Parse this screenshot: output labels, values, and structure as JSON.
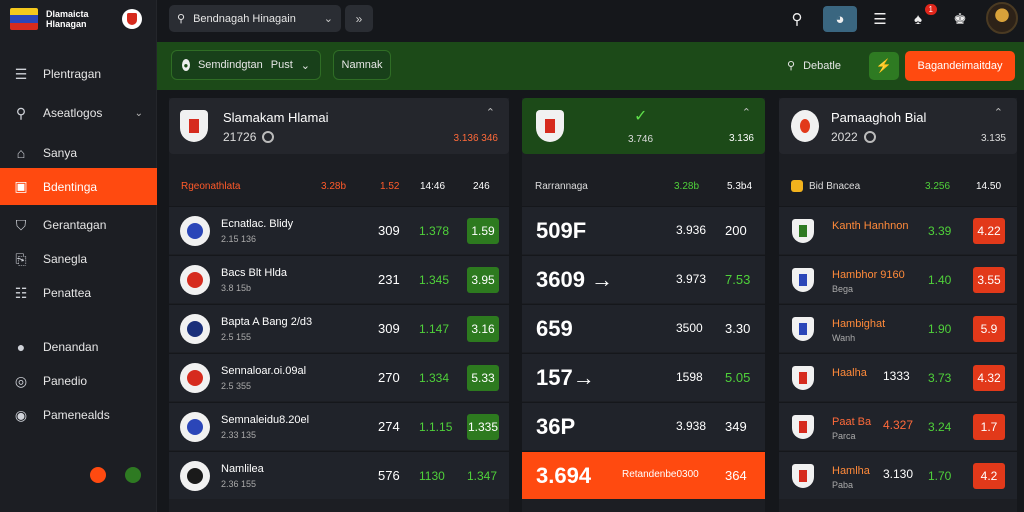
{
  "brand": {
    "line1": "Dlamaicta",
    "line2": "Hlanagan"
  },
  "sidebar": {
    "items": [
      {
        "label": "Plentragan",
        "icon": "menu-icon"
      },
      {
        "label": "Aseatlogos",
        "icon": "search-icon",
        "chevron": true
      },
      {
        "label": "Sanya",
        "icon": "home-icon"
      },
      {
        "label": "Bdentinga",
        "icon": "ticket-icon",
        "active": true
      },
      {
        "label": "Gerantagan",
        "icon": "shield-icon"
      },
      {
        "label": "Sanegla",
        "icon": "coupon-icon"
      },
      {
        "label": "Penattea",
        "icon": "list-icon"
      },
      {
        "label": "Denandan",
        "icon": "user-icon"
      },
      {
        "label": "Panedio",
        "icon": "gift-icon"
      },
      {
        "label": "Pamenealds",
        "icon": "chat-icon"
      }
    ],
    "dots": [
      {
        "color": "#ff4a10"
      },
      {
        "color": "#2e7a22"
      }
    ]
  },
  "topbar": {
    "search_placeholder": "Bendnagah Hinagain",
    "notif_count": "1"
  },
  "filterbar": {
    "league_label": "Semdindgtan",
    "league_value": "Pust",
    "tab_label": "Namnak",
    "search_label": "Debatle",
    "cta_label": "Bagandeimaitday"
  },
  "cards": [
    {
      "title": "Slamakam Hlamai",
      "sub": "21726",
      "odds": "3.136 346",
      "odds_color": "#ff6a3a"
    },
    {
      "title": "",
      "sub": "3.746",
      "odds": "3.136",
      "odds_color": "#ffffff"
    },
    {
      "title": "Pamaaghoh Bial",
      "sub": "2022",
      "odds": "3.135",
      "odds_color": "#dddddd"
    }
  ],
  "left_table": {
    "headers": [
      "Rgeonathlata",
      "3.28b",
      "1.52",
      "14:46",
      "246"
    ],
    "rows": [
      {
        "name": "Ecnatlac. Blidy",
        "sub": "2.15 136",
        "n1": "309",
        "n2": "1.378",
        "n3": "1.59",
        "box": "g"
      },
      {
        "name": "Bacs Blt Hlda",
        "sub": "3.8 15b",
        "n1": "231",
        "n2": "1.345",
        "n3": "3.95",
        "box": "g"
      },
      {
        "name": "Bapta A Bang 2/d3",
        "sub": "2.5 155",
        "n1": "309",
        "n2": "1.147",
        "n3": "3.16",
        "box": "g"
      },
      {
        "name": "Sennaloar.oi.09al",
        "sub": "2.5 355",
        "n1": "270",
        "n2": "1.334",
        "n3": "5.33",
        "box": "g"
      },
      {
        "name": "Semnaleidu8.20el",
        "sub": "2.33 135",
        "n1": "274",
        "n2": "1.1.15",
        "n3": "1.335",
        "box": "g"
      },
      {
        "name": "Namlilea",
        "sub": "2.36 155",
        "n1": "576",
        "n2": "1130",
        "n3": "1.347",
        "box": "none"
      }
    ]
  },
  "mid_table": {
    "header": "Rarrannaga",
    "headers_green": "3.28b",
    "headers_white": "5.3b4",
    "rows": [
      {
        "big": "509F",
        "n1": "3.936",
        "n2": "200",
        "green": false
      },
      {
        "big": "3609 →",
        "n1": "3.973",
        "n2": "7.53",
        "green": true
      },
      {
        "big": "659",
        "n1": "3500",
        "n2": "3.30",
        "green": false
      },
      {
        "big": "157→",
        "n1": "1598",
        "n2": "5.05",
        "green": true
      },
      {
        "big": "36P",
        "n1": "3.938",
        "n2": "349",
        "green": false
      },
      {
        "big": "3.694",
        "n1": "Retandenbe0300",
        "n2": "364",
        "highlight": true
      }
    ]
  },
  "right_table": {
    "header": "Bid Bnacea",
    "h1": "3.256",
    "h2": "14.50",
    "rows": [
      {
        "name": "Kanth Hanhnon",
        "sub": "",
        "n1": "",
        "g": "3.39",
        "box": "4.22",
        "name_color": "#ff8a3a"
      },
      {
        "name": "Hambhor 9160",
        "sub": "Bega",
        "n1": "",
        "g": "1.40",
        "box": "3.55",
        "name_color": "#ff8a3a"
      },
      {
        "name": "Hambighat",
        "sub": "Wanh",
        "n1": "",
        "g": "1.90",
        "box": "5.9",
        "name_color": "#ff8a3a"
      },
      {
        "name": "Haalha",
        "sub": "",
        "n1": "1333",
        "g": "3.73",
        "box": "4.32",
        "name_color": "#ff8a3a"
      },
      {
        "name": "Paat Ba",
        "sub": "Parca",
        "n1": "4.327",
        "g": "3.24",
        "box": "1.7",
        "name_color": "#ff6a3a"
      },
      {
        "name": "Hamlha",
        "sub": "Paba",
        "n1": "3.130",
        "g": "1.70",
        "box": "4.2",
        "name_color": "#ff8a3a"
      }
    ]
  },
  "colors": {
    "accent": "#ff4a10",
    "green": "#2d7a1f",
    "bright_green": "#4fd13a",
    "bg": "#15171b"
  }
}
